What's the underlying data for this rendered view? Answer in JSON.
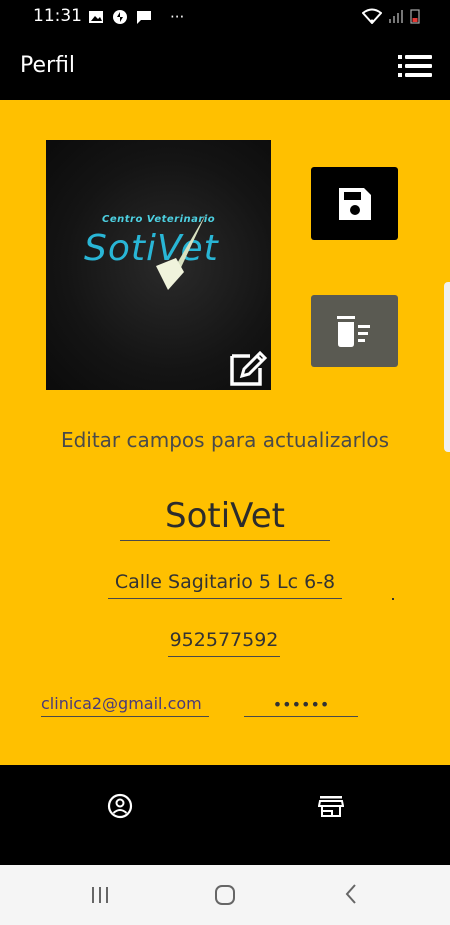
{
  "status_bar": {
    "time": "11:31",
    "more": "···"
  },
  "app_bar": {
    "title": "Perfil"
  },
  "profile_image": {
    "logo_small": "Centro Veterinario",
    "logo_big": "SotiVet"
  },
  "hint": "Editar campos para actualizarlos",
  "form": {
    "name": "SotiVet",
    "address": "Calle Sagitario 5 Lc 6-8",
    "phone": "952577592",
    "email": "clinica2@gmail.com",
    "password": "••••••"
  },
  "colors": {
    "background": "#FFC000",
    "bars": "#000000",
    "delete_button": "#5A5A52"
  },
  "icons": {
    "menu": "list-icon",
    "edit": "edit-icon",
    "save": "save-icon",
    "delete": "delete-sweep-icon",
    "nav_profile": "account-circle-icon",
    "nav_store": "store-icon"
  }
}
